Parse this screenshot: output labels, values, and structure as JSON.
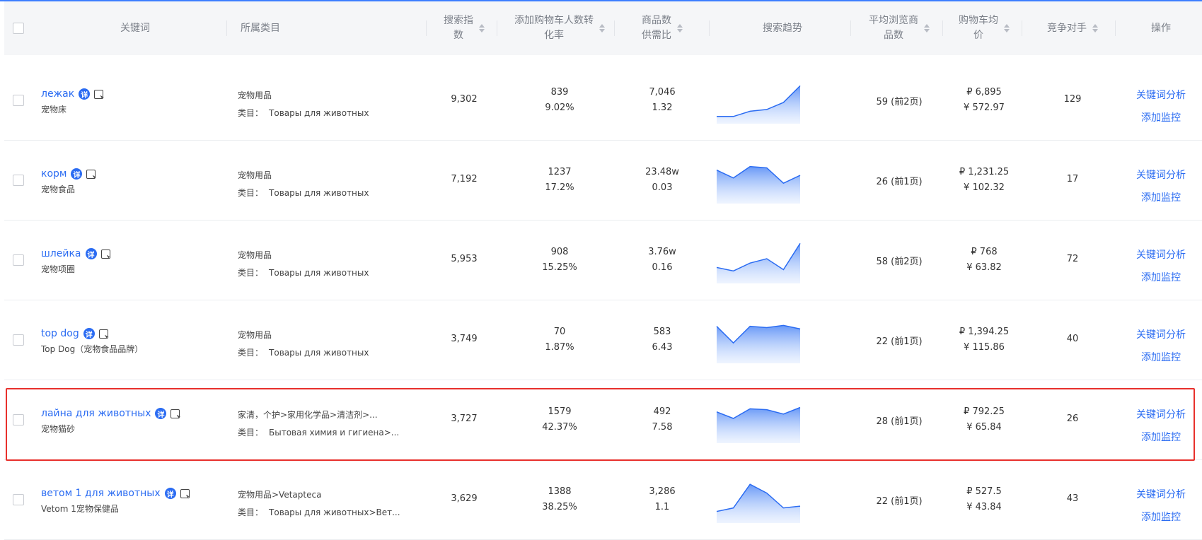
{
  "header": {
    "keyword": "关键词",
    "category": "所属类目",
    "search_index": "搜索指\n数",
    "cart_conversion": "添加购物车人数转\n化率",
    "supply_demand": "商品数\n供需比",
    "trend": "搜索趋势",
    "avg_browse": "平均浏览商\n品数",
    "cart_avg_price": "购物车均\n价",
    "competitors": "竞争对手",
    "actions": "操作"
  },
  "actions": {
    "analyze": "关键词分析",
    "monitor": "添加监控"
  },
  "detail_badge": "详",
  "cat_label": "类目：",
  "rows": [
    {
      "keyword": "лежак",
      "sub": "宠物床",
      "cat1": "宠物用品",
      "cat2": "Товары для животных",
      "search": "9,302",
      "cart_count": "839",
      "cart_rate": "9.02%",
      "supply": "7,046",
      "ratio": "1.32",
      "browse": "59 (前2页)",
      "price_rub": "₽ 6,895",
      "price_cny": "¥ 572.97",
      "competitors": "129",
      "trend": [
        10,
        10,
        22,
        26,
        42,
        80
      ]
    },
    {
      "keyword": "корм",
      "sub": "宠物食品",
      "cat1": "宠物用品",
      "cat2": "Товары для животных",
      "search": "7,192",
      "cart_count": "1237",
      "cart_rate": "17.2%",
      "supply": "23.48w",
      "ratio": "0.03",
      "browse": "26 (前1页)",
      "price_rub": "₽ 1,231.25",
      "price_cny": "¥ 102.32",
      "competitors": "17",
      "trend": [
        70,
        52,
        78,
        75,
        40,
        58
      ]
    },
    {
      "keyword": "шлейка",
      "sub": "宠物项圈",
      "cat1": "宠物用品",
      "cat2": "Товары для животных",
      "search": "5,953",
      "cart_count": "908",
      "cart_rate": "15.25%",
      "supply": "3.76w",
      "ratio": "0.16",
      "browse": "58 (前2页)",
      "price_rub": "₽ 768",
      "price_cny": "¥ 63.82",
      "competitors": "72",
      "trend": [
        30,
        22,
        40,
        50,
        25,
        85
      ]
    },
    {
      "keyword": "top dog",
      "sub": "Top Dog（宠物食品品牌）",
      "cat1": "宠物用品",
      "cat2": "Товары для животных",
      "search": "3,749",
      "cart_count": "70",
      "cart_rate": "1.87%",
      "supply": "583",
      "ratio": "6.43",
      "browse": "22 (前1页)",
      "price_rub": "₽ 1,394.25",
      "price_cny": "¥ 115.86",
      "competitors": "40",
      "trend": [
        78,
        40,
        78,
        75,
        80,
        72
      ]
    },
    {
      "keyword": "лайна для животных",
      "sub": "宠物猫砂",
      "cat1": "家清，个护>家用化学品>清洁剂>...",
      "cat2": "Бытовая химия и гигиена>...",
      "search": "3,727",
      "cart_count": "1579",
      "cart_rate": "42.37%",
      "supply": "492",
      "ratio": "7.58",
      "browse": "28 (前1页)",
      "price_rub": "₽ 792.25",
      "price_cny": "¥ 65.84",
      "competitors": "26",
      "trend": [
        65,
        50,
        72,
        70,
        60,
        75
      ]
    },
    {
      "keyword": "ветом 1 для животных",
      "sub": "Vetom 1宠物保健品",
      "cat1": "宠物用品>Vetapteca",
      "cat2": "Товары для животных>Вет...",
      "search": "3,629",
      "cart_count": "1388",
      "cart_rate": "38.25%",
      "supply": "3,286",
      "ratio": "1.1",
      "browse": "22 (前1页)",
      "price_rub": "₽ 527.5",
      "price_cny": "¥ 43.84",
      "competitors": "43",
      "trend": [
        20,
        28,
        82,
        62,
        28,
        32
      ]
    }
  ]
}
